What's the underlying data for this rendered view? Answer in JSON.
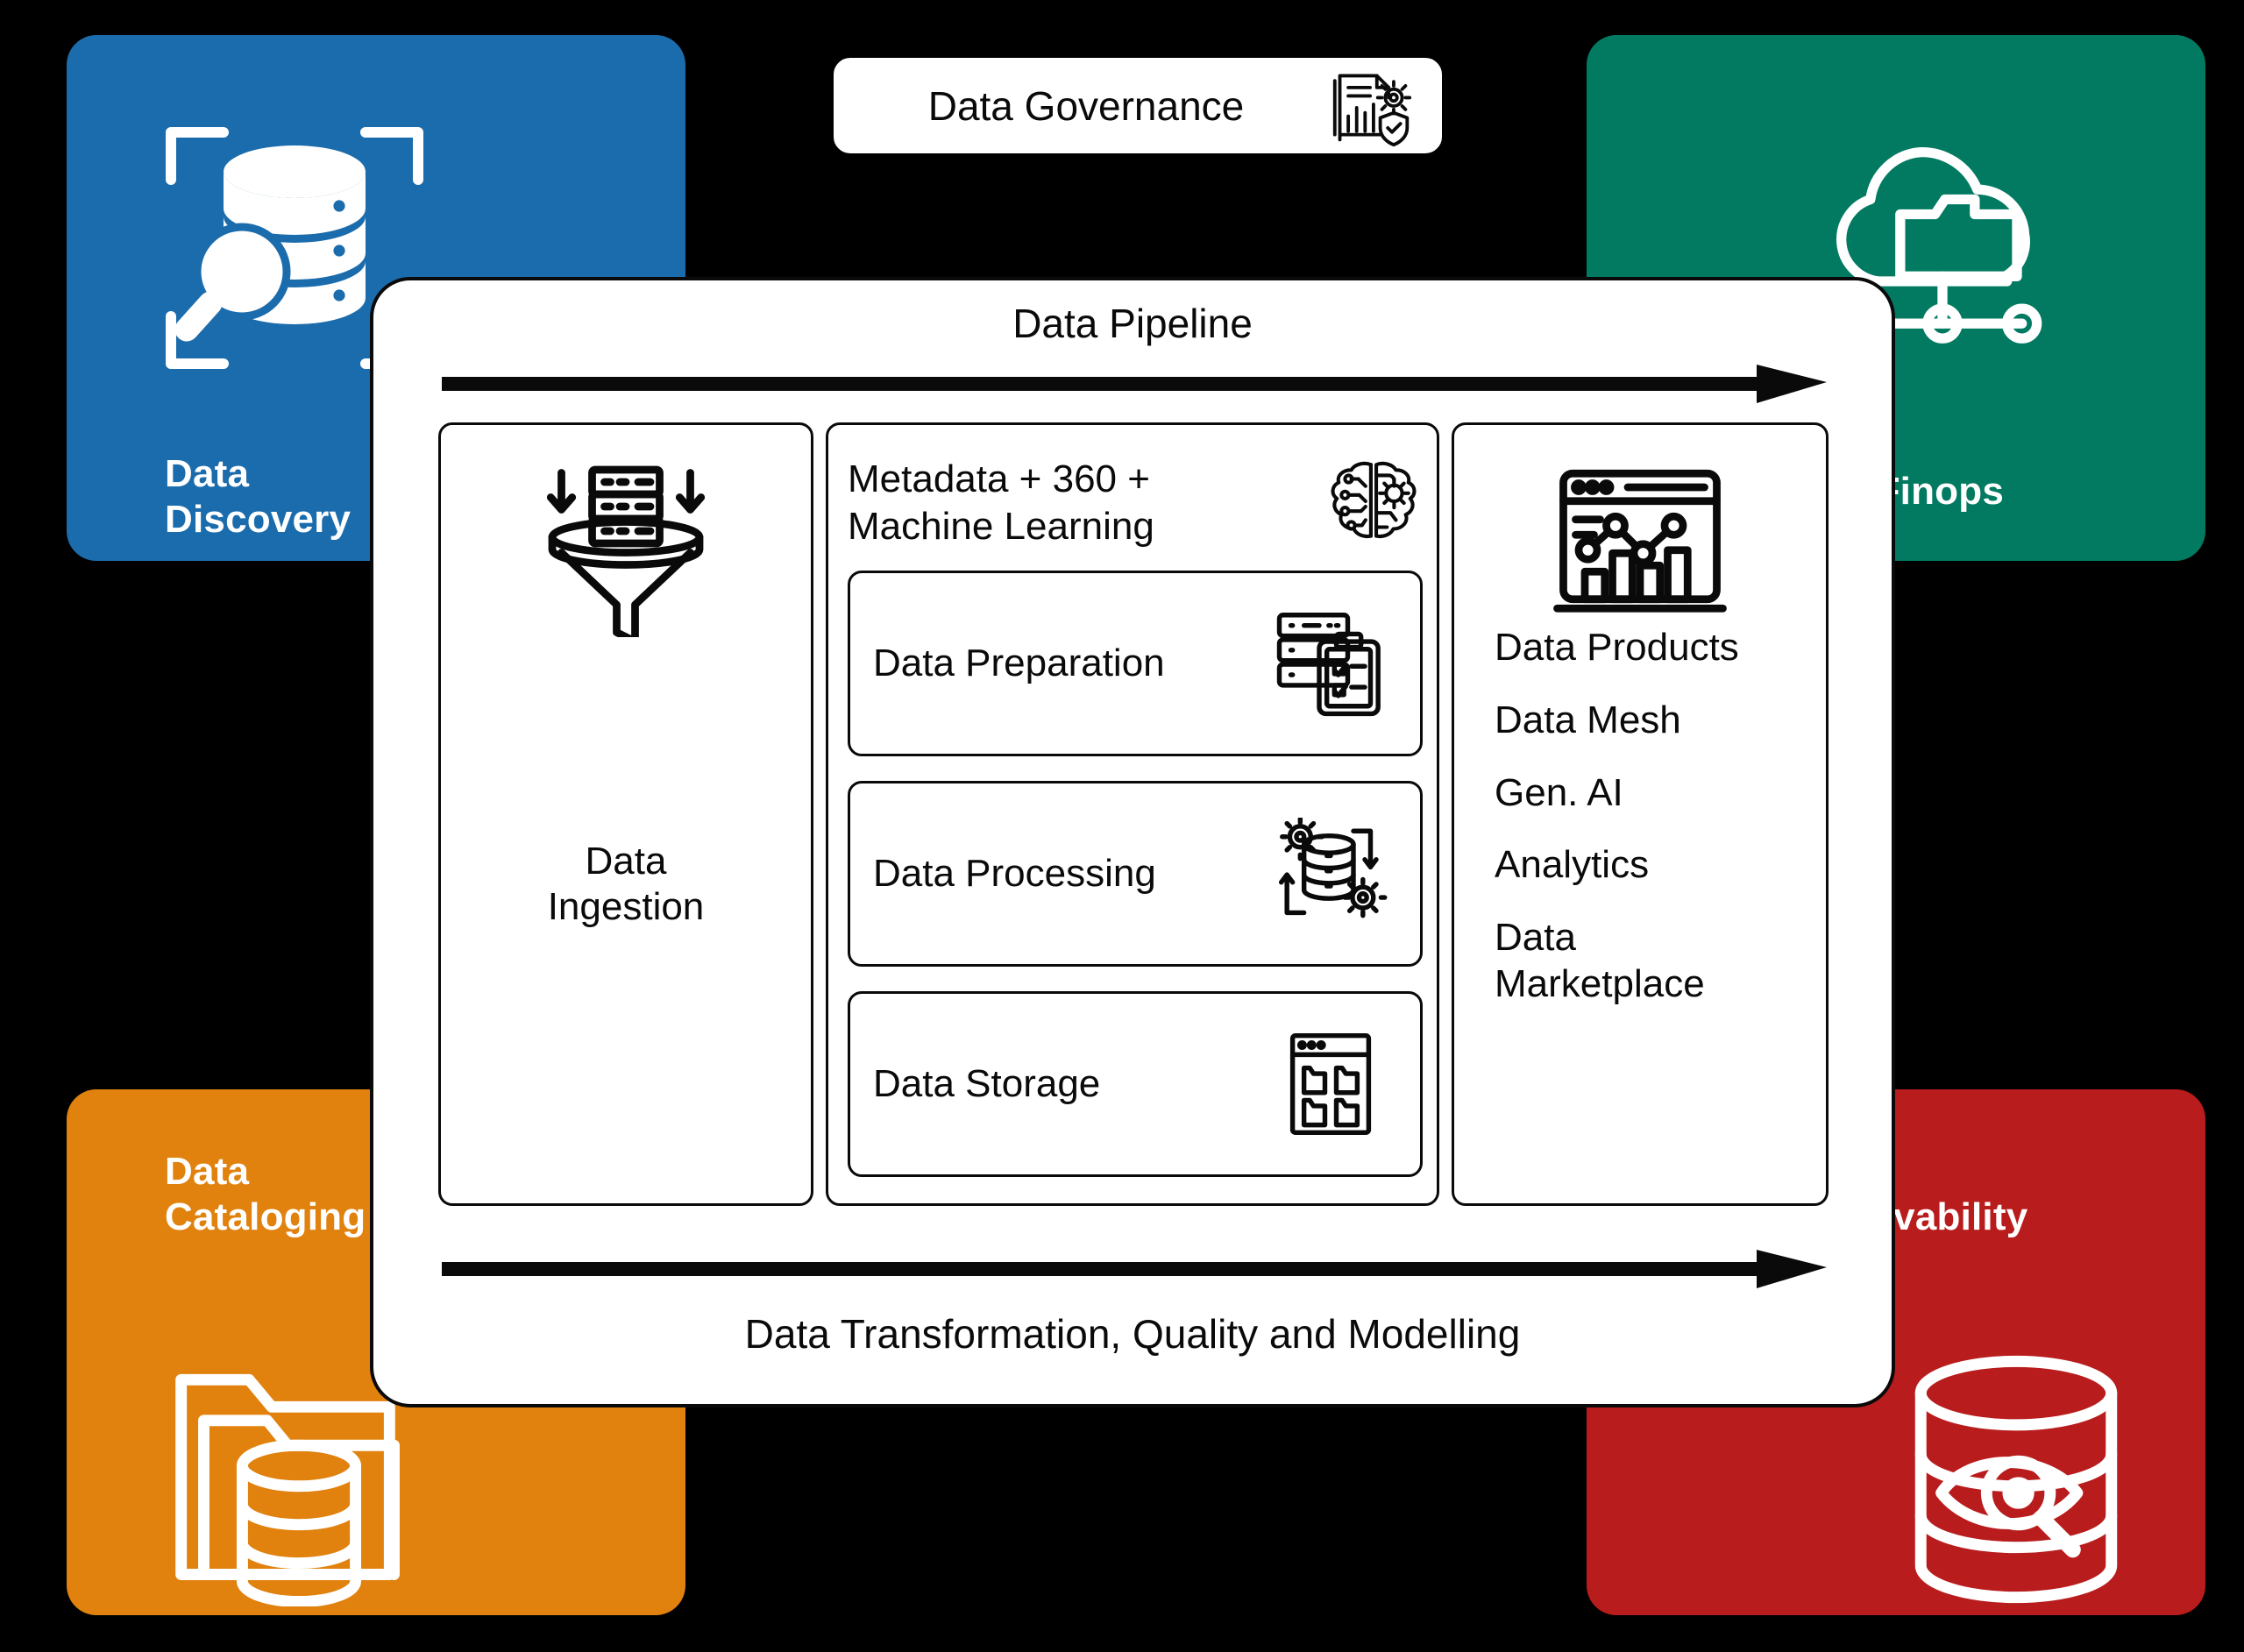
{
  "colors": {
    "discovery": "#1b6cac",
    "finops": "#017a61",
    "cataloging": "#e1820f",
    "observability": "#b91c1c",
    "background": "#000000",
    "panel": "#ffffff",
    "stroke": "#0a0a0a"
  },
  "corner_cards": [
    {
      "id": "discovery",
      "title": "Data\nDiscovery",
      "icon": "database-search-icon"
    },
    {
      "id": "finops",
      "title": "Data Finops",
      "icon": "cloud-folder-network-icon"
    },
    {
      "id": "cataloging",
      "title": "Data\nCataloging",
      "icon": "folder-database-icon"
    },
    {
      "id": "observability",
      "title": "Data\nObservability",
      "icon": "database-eye-icon"
    }
  ],
  "governance": {
    "label": "Data Governance",
    "icon": "document-chart-shield-gear-icon"
  },
  "pipeline": {
    "title": "Data Pipeline",
    "footer": "Data Transformation, Quality and Modelling",
    "top_arrow_icon": "right-arrow-icon",
    "bottom_arrow_icon": "right-arrow-icon",
    "stages": {
      "ingestion": {
        "label": "Data\nIngestion",
        "icon": "funnel-server-icon"
      },
      "middle": {
        "header": {
          "label": "Metadata + 360 +\nMachine Learning",
          "icon": "brain-circuit-icon"
        },
        "items": [
          {
            "label": "Data Preparation",
            "icon": "server-clipboard-checklist-icon"
          },
          {
            "label": "Data Processing",
            "icon": "database-gears-cycle-icon"
          },
          {
            "label": "Data Storage",
            "icon": "browser-folders-icon"
          }
        ]
      },
      "output": {
        "icon": "dashboard-analytics-icon",
        "items": [
          "Data Products",
          "Data Mesh",
          "Gen. AI",
          "Analytics",
          "Data\nMarketplace"
        ]
      }
    }
  }
}
